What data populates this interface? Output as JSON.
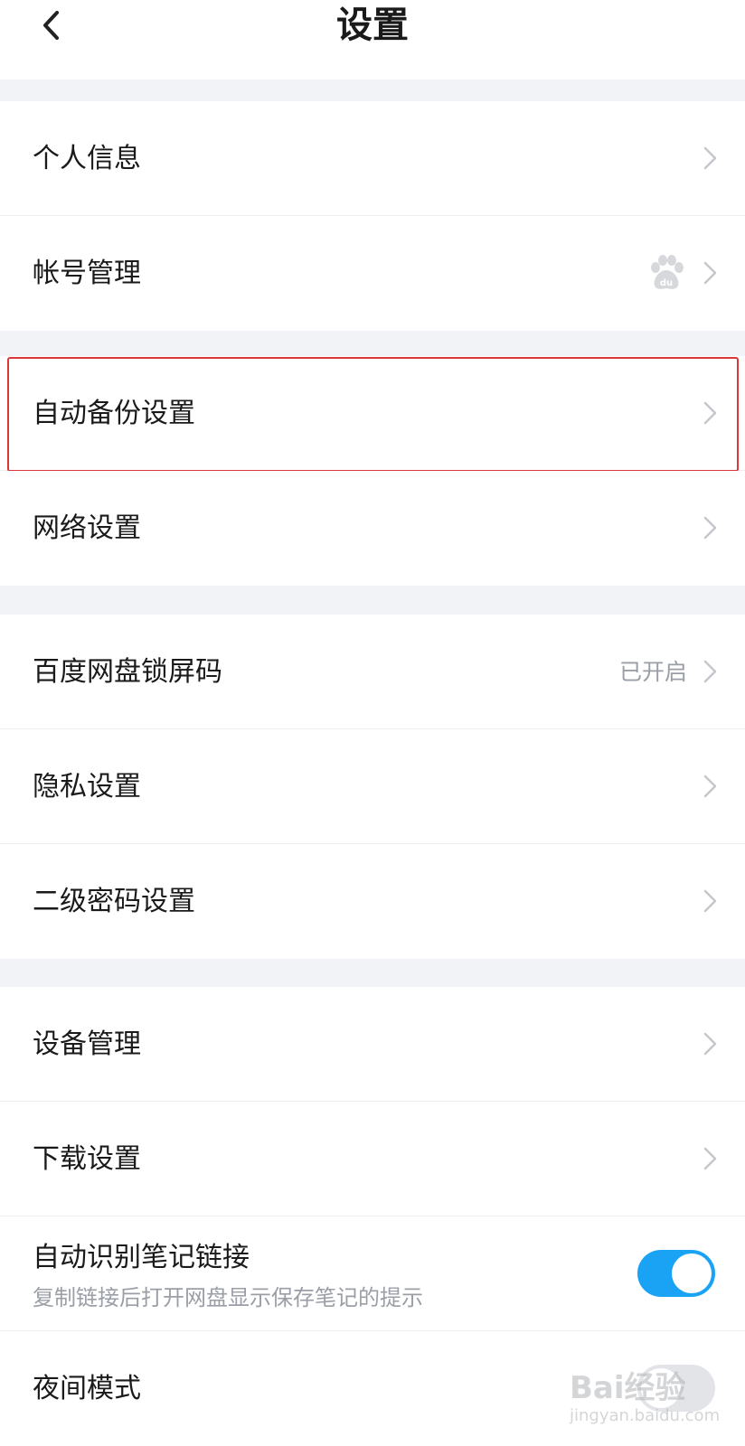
{
  "header": {
    "title": "设置"
  },
  "groups": [
    {
      "items": [
        {
          "label": "个人信息"
        },
        {
          "label": "帐号管理",
          "badge_icon": "baidu-paw-icon"
        }
      ]
    },
    {
      "items": [
        {
          "label": "自动备份设置",
          "highlighted": true
        },
        {
          "label": "网络设置"
        }
      ]
    },
    {
      "items": [
        {
          "label": "百度网盘锁屏码",
          "value": "已开启"
        },
        {
          "label": "隐私设置"
        },
        {
          "label": "二级密码设置"
        }
      ]
    },
    {
      "items": [
        {
          "label": "设备管理"
        },
        {
          "label": "下载设置"
        },
        {
          "label": "自动识别笔记链接",
          "description": "复制链接后打开网盘显示保存笔记的提示",
          "toggle": true
        },
        {
          "label": "夜间模式",
          "toggle": false
        }
      ]
    }
  ],
  "colors": {
    "accent": "#1aa3f5",
    "highlight_border": "#d9383a",
    "background_gap": "#f2f3f6"
  },
  "watermark": {
    "brand": "Bai经验",
    "site": "jingyan.baidu.com"
  }
}
